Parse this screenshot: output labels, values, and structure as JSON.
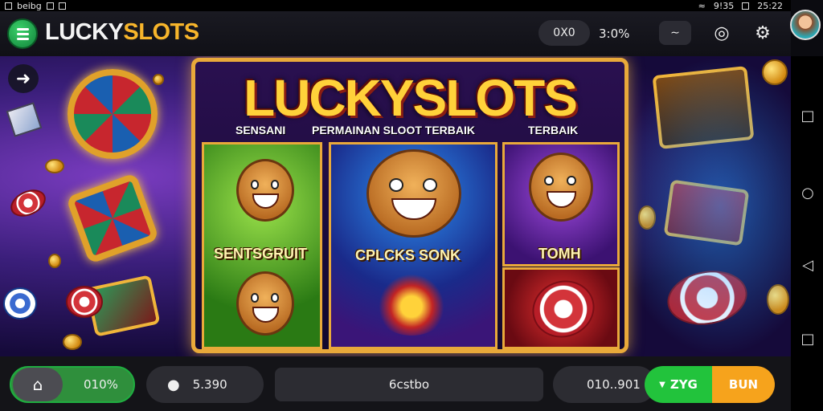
{
  "statusbar": {
    "carrier": "beibg",
    "signal": "9!35",
    "time": "25:22"
  },
  "header": {
    "logo_light": "LUCKY",
    "logo_gold": "SLOTS",
    "balance_pill": "0X0",
    "stat": "3:0%",
    "icons": [
      "menu-icon",
      "chart-icon",
      "target-icon",
      "gear-icon",
      "avatar"
    ]
  },
  "board": {
    "title": "LUCKYSLOTS",
    "subtitle_left": "SENSANI",
    "subtitle_center": "PERMAINAN SLOOT TERBAIK",
    "subtitle_right": "TERBAIK",
    "reel_labels": [
      "SENTSGRUIT",
      "CPLCKS SONK",
      "TOMH"
    ]
  },
  "bottom": {
    "percent": "010%",
    "coins": "5.390",
    "center": "6cstbo",
    "bet": "010..901",
    "spin_left": "ZYG",
    "spin_right": "BUN"
  },
  "colors": {
    "accent_gold": "#f7b52b",
    "accent_green": "#22c33c",
    "accent_orange": "#f6a31c"
  }
}
